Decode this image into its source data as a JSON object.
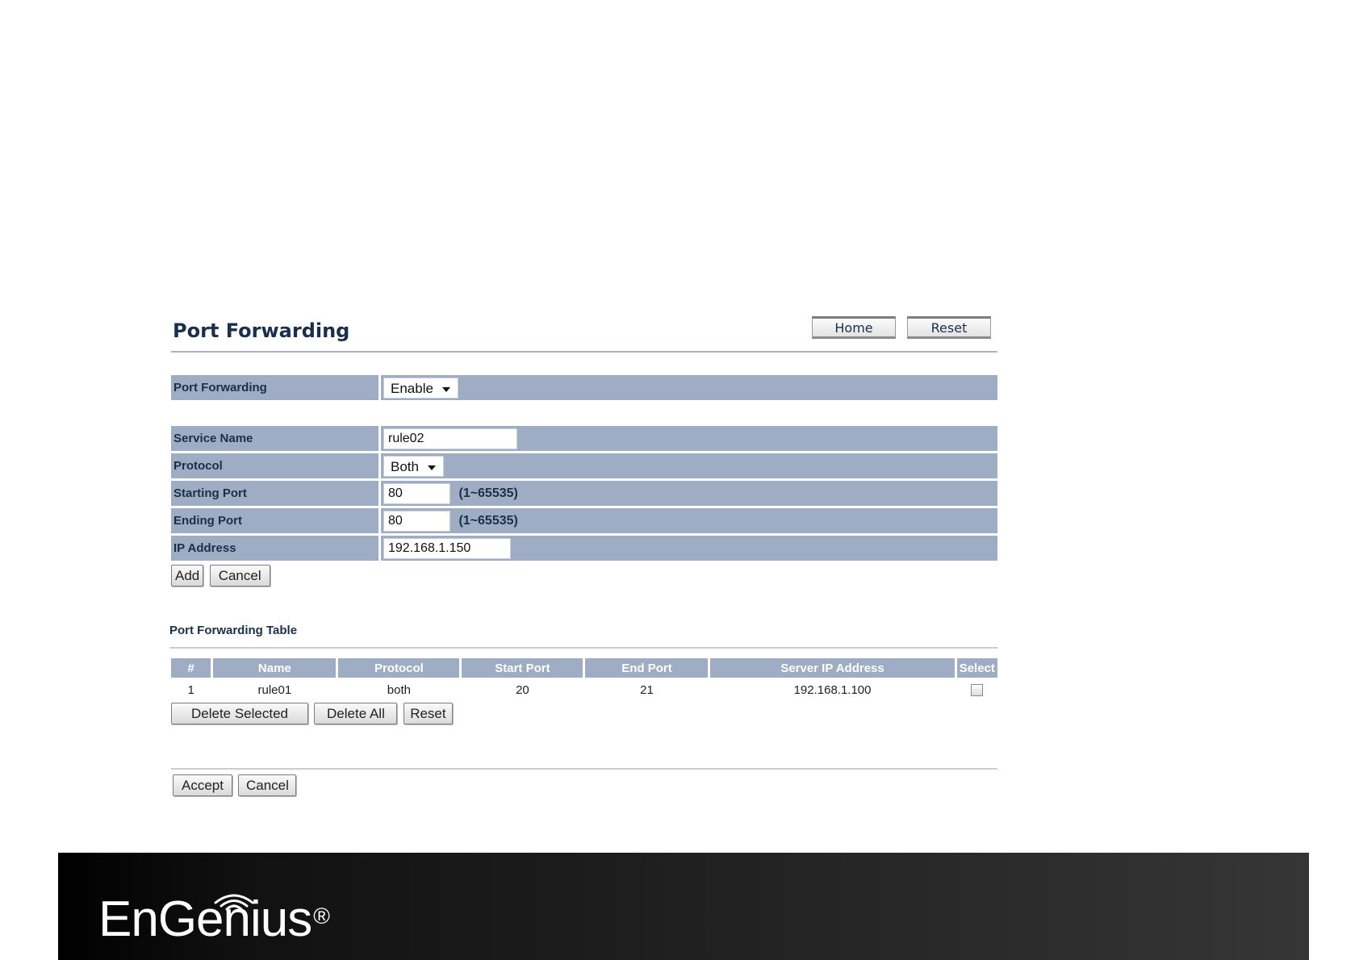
{
  "header": {
    "title": "Port Forwarding",
    "home_label": "Home",
    "reset_label": "Reset"
  },
  "port_forwarding": {
    "label": "Port Forwarding",
    "value": "Enable"
  },
  "form": {
    "service_name": {
      "label": "Service Name",
      "value": "rule02"
    },
    "protocol": {
      "label": "Protocol",
      "value": "Both"
    },
    "starting_port": {
      "label": "Starting Port",
      "value": "80",
      "hint": "(1~65535)"
    },
    "ending_port": {
      "label": "Ending Port",
      "value": "80",
      "hint": "(1~65535)"
    },
    "ip_address": {
      "label": "IP Address",
      "value": "192.168.1.150"
    },
    "add_label": "Add",
    "cancel_label": "Cancel"
  },
  "table": {
    "title": "Port Forwarding Table",
    "columns": [
      "#",
      "Name",
      "Protocol",
      "Start Port",
      "End Port",
      "Server IP Address",
      "Select"
    ],
    "rows": [
      {
        "num": "1",
        "name": "rule01",
        "protocol": "both",
        "start": "20",
        "end": "21",
        "ip": "192.168.1.100",
        "selected": false
      }
    ],
    "delete_selected_label": "Delete Selected",
    "delete_all_label": "Delete All",
    "reset_label": "Reset"
  },
  "footer_actions": {
    "accept_label": "Accept",
    "cancel_label": "Cancel"
  },
  "brand": {
    "logo_text": "EnGenius",
    "registered": "®"
  },
  "colors": {
    "row_background": "#9eacc4",
    "title_text": "#1c2f4a",
    "footer_background": "#1a1a1a"
  }
}
